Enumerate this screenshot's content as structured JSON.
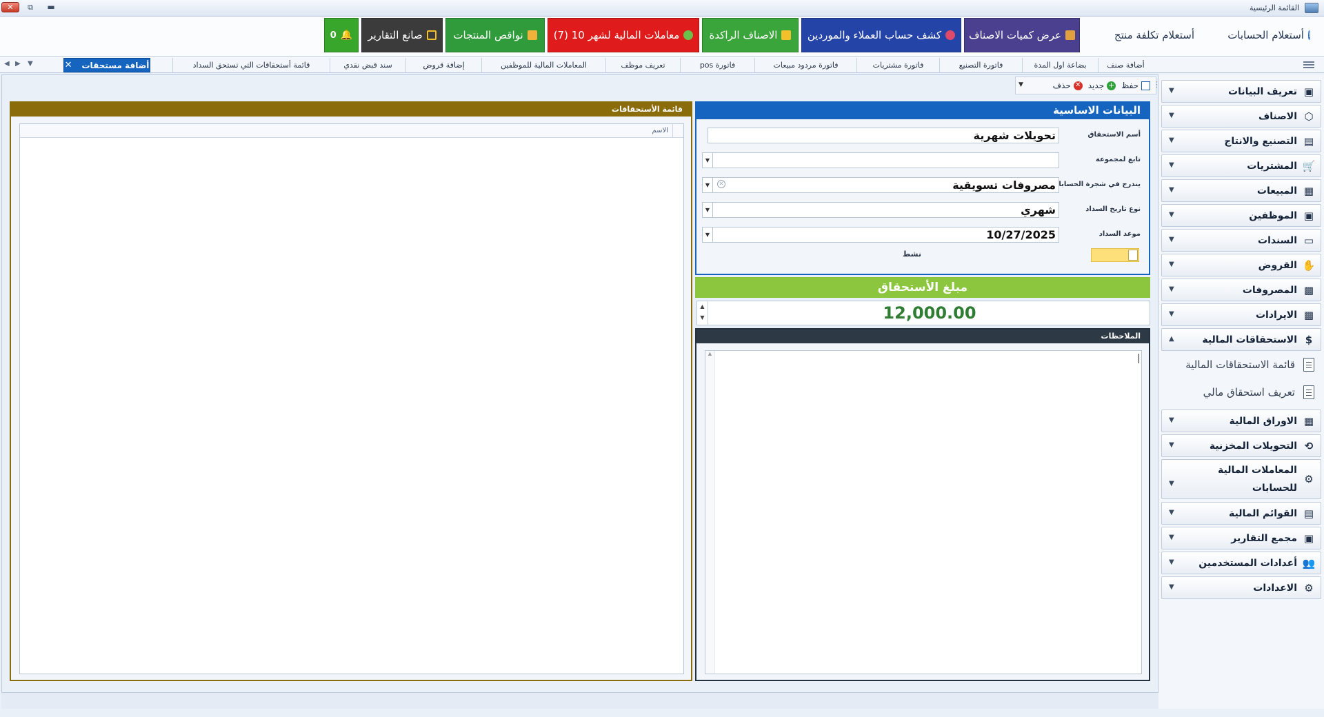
{
  "window": {
    "title": "القائمة الرئيسية"
  },
  "ribbon": {
    "accounts_inquiry": "أستعلام الحسابات",
    "product_cost_inquiry": "أستعلام تكلفة منتج",
    "show_item_quantities": "عرض كميات الاصناف",
    "customer_supplier_statement": "كشف حساب العملاء والموردين",
    "slow_items": "الاصناف الراكدة",
    "financial_transactions": "معاملات المالية لشهر 10  (7)",
    "product_shortages": "نواقص المنتجات",
    "report_maker": "صانع التقارير",
    "notifications_count": "0",
    "colors": {
      "purple": "#4b3f8f",
      "blue": "#2544a8",
      "green": "#3aa53a",
      "red": "#e01b1b",
      "darkgreen": "#2f9b3b",
      "dark": "#3b3b3b",
      "lime": "#37a62b"
    }
  },
  "tabs": [
    "أضافة صنف",
    "بضاعة اول المدة",
    "فاتورة التصنيع",
    "فاتورة مشتريات",
    "فاتورة مردود مبيعات",
    "فاتورة pos",
    "تعريف موظف",
    "المعاملات المالية للموظفين",
    "إضافة قروض",
    "سند قبض نقدي",
    "قائمة أستحقاقات التي تستحق السداد"
  ],
  "active_tab": "أضافة مستحقات",
  "toolbar": {
    "save": "حفظ",
    "new": "جديد",
    "delete": "حذف"
  },
  "basic": {
    "title": "البيانات الاساسية",
    "fields": [
      {
        "label": "أسم الاستحقاق",
        "value": "تحويلات شهرية"
      },
      {
        "label": "تابع لمجموعة",
        "value": ""
      },
      {
        "label": "يندرج في شجرة الحسابات",
        "value": "مصروفات تسويقية"
      },
      {
        "label": "نوع تاريخ السداد",
        "value": "شهري"
      },
      {
        "label": "موعد السداد",
        "value": "10/27/2025"
      }
    ],
    "active_label": "نشط"
  },
  "amount": {
    "title": "مبلغ الأستحقاق",
    "value": "12,000.00"
  },
  "notes": {
    "title": "الملاحظات"
  },
  "list": {
    "title": "قائمة الأستحقاقات",
    "column_name": "الاسم"
  },
  "sidebar": {
    "items": [
      "تعريف البيانات",
      "الاصناف",
      "التصنيع والانتاج",
      "المشتريات",
      "المبيعات",
      "الموظفين",
      "السندات",
      "القروض",
      "المصروفات",
      "الايرادات",
      "الاستحقاقات المالية"
    ],
    "subitems": [
      "قائمة الاستحقاقات المالية",
      "تعريف استحقاق مالي"
    ],
    "items2": [
      "الاوراق المالية",
      "التحويلات المخزنية",
      "المعاملات المالية للحسابات",
      "القوائم المالية",
      "مجمع التقارير",
      "أعدادات المستخدمين",
      "الاعدادات"
    ]
  }
}
